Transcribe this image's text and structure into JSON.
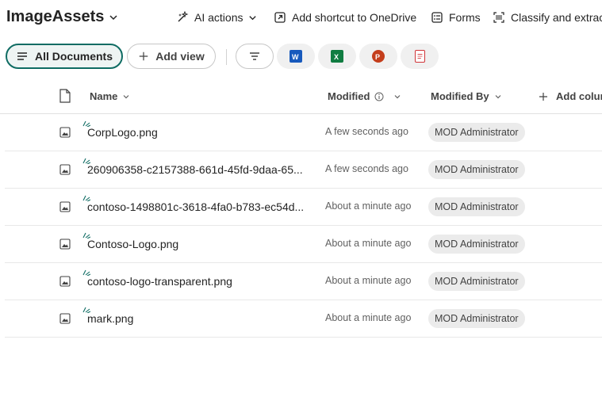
{
  "header": {
    "library_title": "ImageAssets",
    "commands": [
      {
        "label": "AI actions",
        "icon": "sparkle-wand-icon"
      },
      {
        "label": "Add shortcut to OneDrive",
        "icon": "shortcut-arrow-icon"
      },
      {
        "label": "Forms",
        "icon": "forms-icon"
      },
      {
        "label": "Classify and extrac",
        "icon": "scan-icon"
      }
    ]
  },
  "views": {
    "active_label": "All Documents",
    "add_view_label": "Add view",
    "app_buttons": [
      {
        "name": "word",
        "color": "#185abd"
      },
      {
        "name": "excel",
        "color": "#107c41"
      },
      {
        "name": "powerpoint",
        "color": "#c43e1c"
      },
      {
        "name": "pdf",
        "color": "#d13438"
      }
    ]
  },
  "columns": {
    "name": "Name",
    "modified": "Modified",
    "modified_by": "Modified By",
    "add_column": "Add colum"
  },
  "rows": [
    {
      "name": "CorpLogo.png",
      "modified": "A few seconds ago",
      "modified_by": "MOD Administrator"
    },
    {
      "name": "260906358-c2157388-661d-45fd-9daa-65...",
      "modified": "A few seconds ago",
      "modified_by": "MOD Administrator"
    },
    {
      "name": "contoso-1498801c-3618-4fa0-b783-ec54d...",
      "modified": "About a minute ago",
      "modified_by": "MOD Administrator"
    },
    {
      "name": "Contoso-Logo.png",
      "modified": "About a minute ago",
      "modified_by": "MOD Administrator"
    },
    {
      "name": "contoso-logo-transparent.png",
      "modified": "About a minute ago",
      "modified_by": "MOD Administrator"
    },
    {
      "name": "mark.png",
      "modified": "About a minute ago",
      "modified_by": "MOD Administrator"
    }
  ],
  "colors": {
    "accent": "#0f6c63",
    "new_item_spark": "#0f6c63"
  }
}
